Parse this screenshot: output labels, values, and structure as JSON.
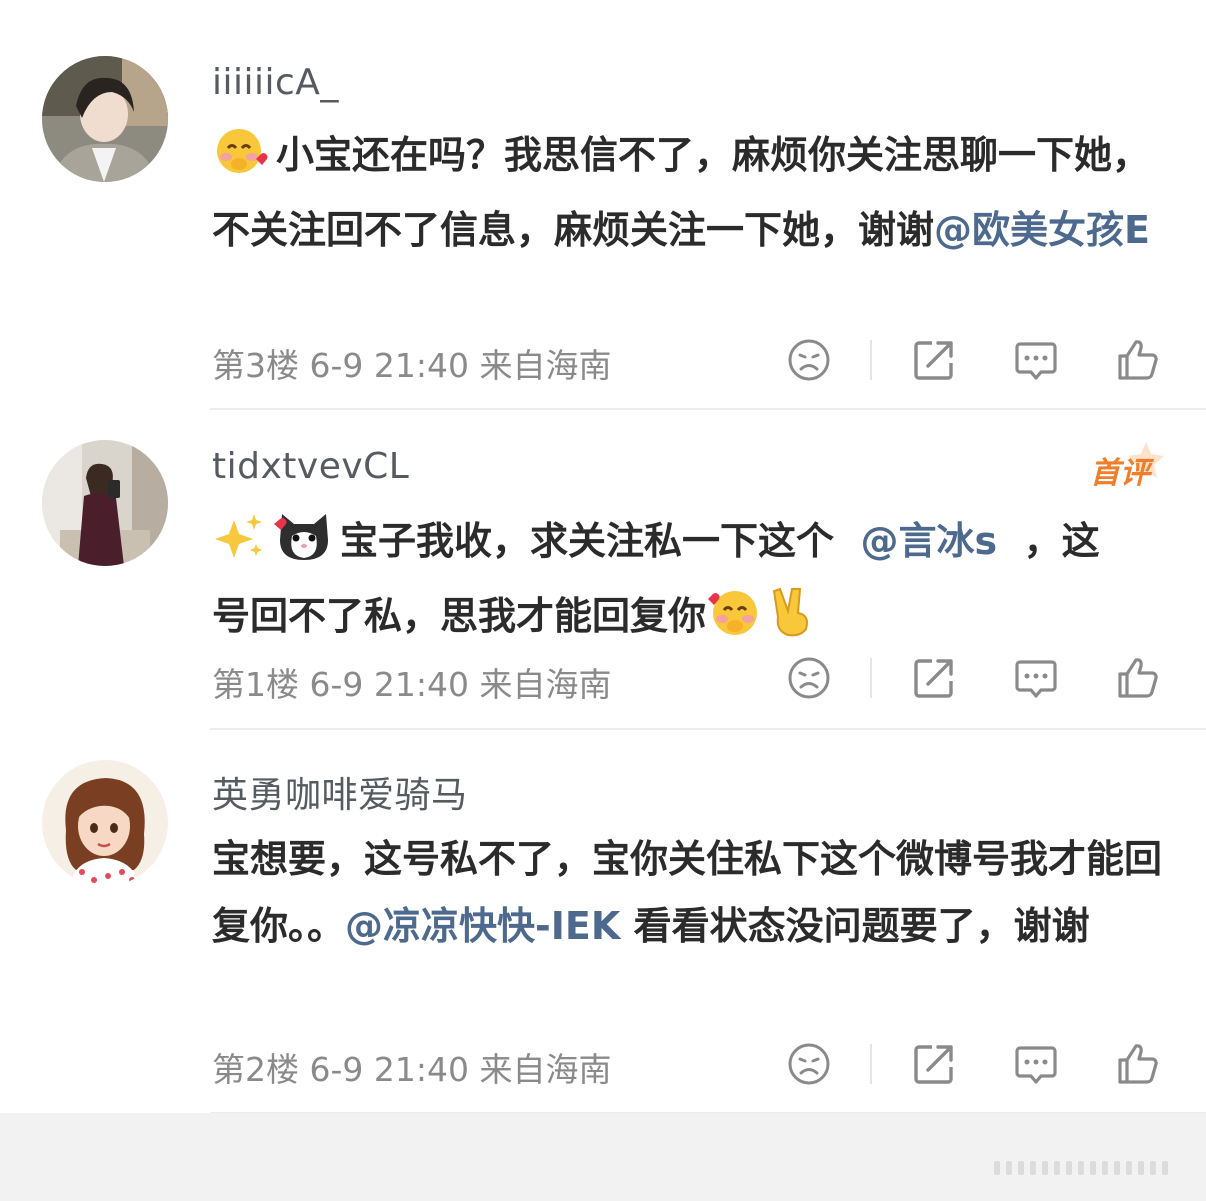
{
  "comments": [
    {
      "username": "iiiiiicA_",
      "body_before": "小宝还在吗？我思信不了，麻烦你关注思聊一下她，不关注回不了信息，麻烦关注一下她，谢谢",
      "mention": "@欧美女孩E",
      "body_after": "",
      "floor": "第3楼",
      "date": "6-9",
      "time": "21:40",
      "location": "来自海南",
      "avatar_icon": "avatar-photo-woman-coat",
      "leading_emoji": "blushing-face-emoji"
    },
    {
      "username": "tidxtvevCL",
      "badge": "首评",
      "body_before": "宝子我收，求关注私一下这个",
      "mention": "@言冰s",
      "body_after": "，这号回不了私，思我才能回复你",
      "floor": "第1楼",
      "date": "6-9",
      "time": "21:40",
      "location": "来自海南",
      "avatar_icon": "avatar-photo-mirror-selfie",
      "leading_emoji": "sparkles-emoji",
      "second_emoji": "cat-face-emoji",
      "trailing_emojis": [
        "blushing-face-emoji",
        "victory-hand-emoji"
      ]
    },
    {
      "username": "英勇咖啡爱骑马",
      "body_before": "宝想要，这号私不了，宝你关住私下这个微博号我才能回复你。。",
      "mention": "@凉凉快快-IEK",
      "body_after": "看看状态没问题要了，谢谢",
      "floor": "第2楼",
      "date": "6-9",
      "time": "21:40",
      "location": "来自海南",
      "avatar_icon": "avatar-cartoon-girl"
    }
  ],
  "action_icons": [
    "dislike-face-icon",
    "share-icon",
    "reply-comment-icon",
    "like-thumb-icon"
  ],
  "colors": {
    "mention": "#4d6a8e",
    "badge": "#f07d2a",
    "meta": "#8a8a8a",
    "username": "#555b61"
  }
}
